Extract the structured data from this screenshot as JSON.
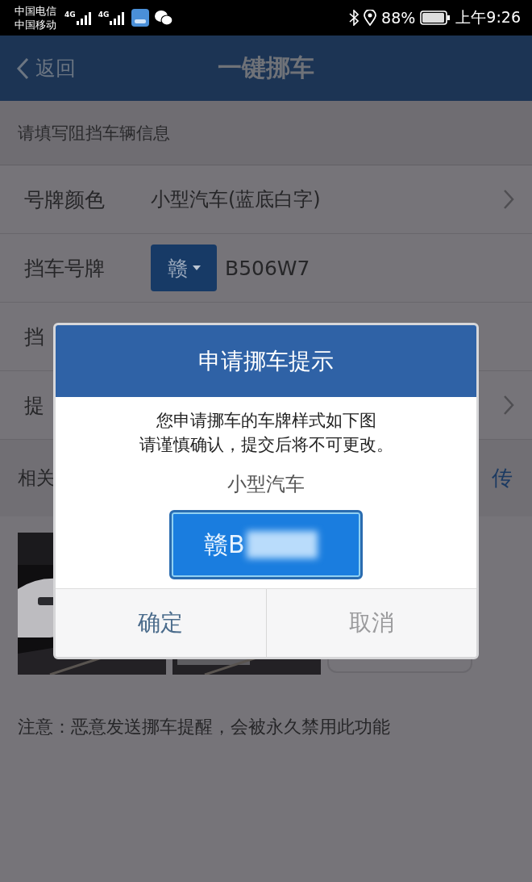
{
  "status_bar": {
    "carriers": [
      "中国电信",
      "中国移动"
    ],
    "network_labels": [
      "4G",
      "4G"
    ],
    "battery": "88%",
    "time": "上午9:26"
  },
  "header": {
    "back": "返回",
    "title": "一键挪车"
  },
  "section_title": "请填写阻挡车辆信息",
  "form_rows": [
    {
      "kind": "select",
      "label": "号牌颜色",
      "value": "小型汽车(蓝底白字)"
    },
    {
      "kind": "plate",
      "label": "挡车号牌",
      "province": "赣",
      "value": "B506W7"
    },
    {
      "kind": "text",
      "label": "挡"
    },
    {
      "kind": "select",
      "label": "提"
    }
  ],
  "photos_section": {
    "label": "相关",
    "action": "传",
    "photos": [
      {
        "kind": "picture"
      },
      {
        "kind": "picture"
      },
      {
        "kind": "upload"
      }
    ]
  },
  "notice": "注意：恶意发送挪车提醒，会被永久禁用此功能",
  "dialog": {
    "title": "申请挪车提示",
    "message": [
      "您申请挪车的车牌样式如下图",
      "请谨慎确认，提交后将不可更改。"
    ],
    "plate_type": "小型汽车",
    "plate_text": "赣B",
    "buttons": [
      {
        "label": "确定",
        "kind": "primary"
      },
      {
        "label": "取消",
        "kind": "secondary"
      }
    ]
  }
}
